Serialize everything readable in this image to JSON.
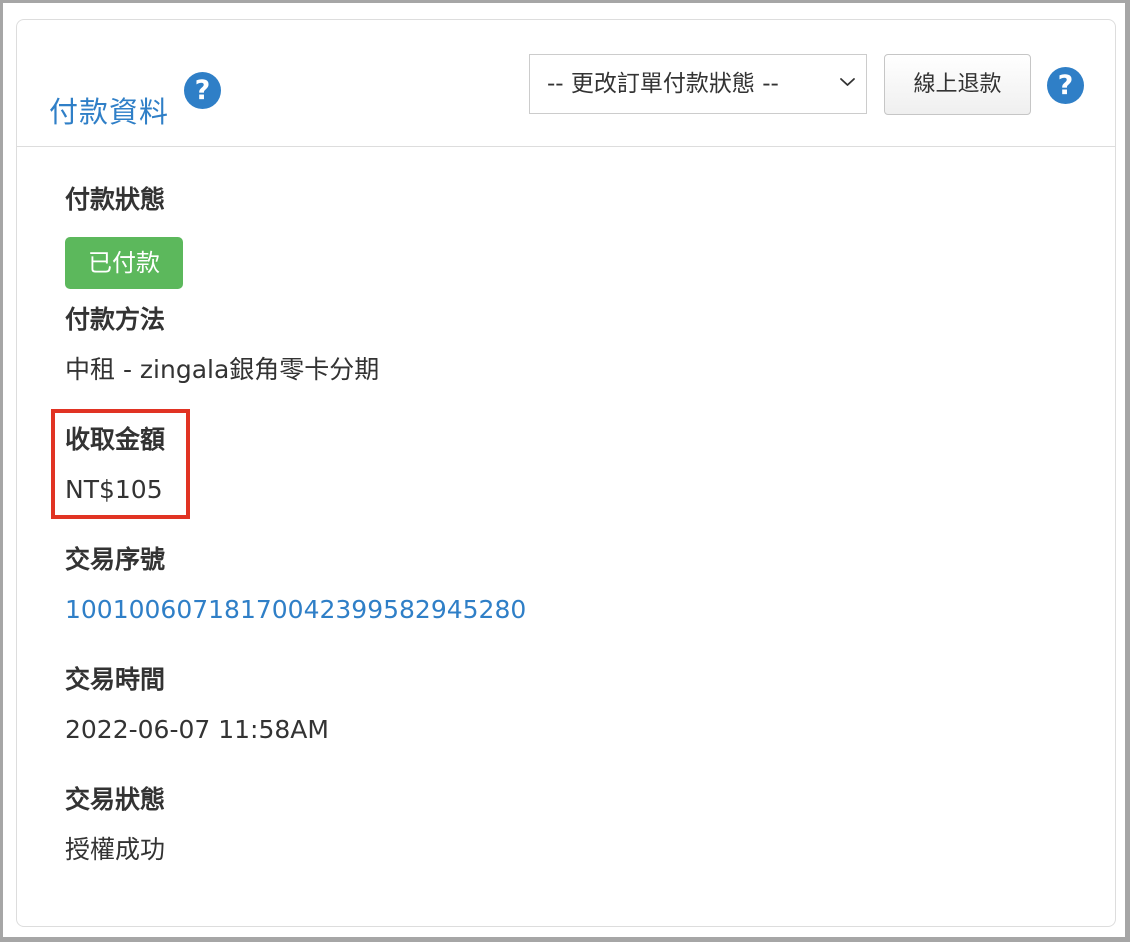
{
  "header": {
    "title": "付款資料",
    "title_help_icon": "question-circle-icon",
    "payment_status_select": {
      "selected_label": "-- 更改訂單付款狀態 --",
      "arrow_icon": "chevron-down-icon"
    },
    "refund_button_label": "線上退款",
    "help_icon": "question-circle-icon"
  },
  "payment_info": {
    "payment_status": {
      "label": "付款狀態",
      "value": "已付款",
      "color": "#5cb85c"
    },
    "payment_method": {
      "label": "付款方法",
      "value": "中租 - zingala銀角零卡分期"
    },
    "amount_collected": {
      "label": "收取金額",
      "value": "NT$105",
      "highlight_color": "#e13323"
    },
    "transaction_number": {
      "label": "交易序號",
      "value": "100100607181700423995829452​80"
    },
    "transaction_time": {
      "label": "交易時間",
      "value": "2022-06-07 11:58AM"
    },
    "transaction_status": {
      "label": "交易狀態",
      "value": "授權成功"
    }
  },
  "colors": {
    "accent": "#2f7fc7",
    "success": "#5cb85c",
    "highlight": "#e13323",
    "text": "#333333"
  }
}
